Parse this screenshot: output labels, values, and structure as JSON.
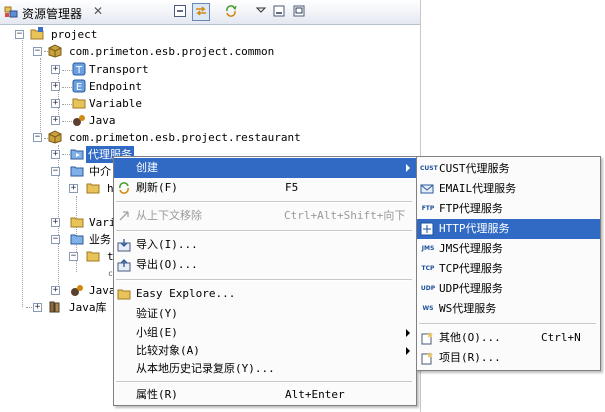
{
  "view": {
    "title": "资源管理器",
    "close_glyph": "✕"
  },
  "tree": {
    "project": "project",
    "common": "com.primeton.esb.project.common",
    "transport": "Transport",
    "endpoint": "Endpoint",
    "variable": "Variable",
    "java": "Java",
    "restaurant": "com.primeton.esb.project.restaurant",
    "proxy_service": "代理服务",
    "intermediary_partial": "中介",
    "vari_partial": "Vari",
    "business_partial": "业务",
    "java2_partial": "Java",
    "javalib": "Java库",
    "h_partial": "h",
    "t_partial": "t",
    "c_partial": "c"
  },
  "context_menu": {
    "create": "创建",
    "refresh": "刷新(F)",
    "refresh_accel": "F5",
    "remove": "从上下文移除",
    "remove_accel": "Ctrl+Alt+Shift+向下",
    "import": "导入(I)...",
    "export": "导出(O)...",
    "easy_explore": "Easy Explore...",
    "validate": "验证(Y)",
    "group": "小组(E)",
    "compare": "比较对象(A)",
    "restore_history": "从本地历史记录复原(Y)...",
    "properties": "属性(R)",
    "properties_accel": "Alt+Enter"
  },
  "submenu": {
    "items": [
      {
        "tag": "CUST",
        "label": "CUST代理服务"
      },
      {
        "tag": "EMAIL",
        "label": "EMAIL代理服务"
      },
      {
        "tag": "FTP",
        "label": "FTP代理服务"
      },
      {
        "tag": "HTTP",
        "label": "HTTP代理服务"
      },
      {
        "tag": "JMS",
        "label": "JMS代理服务"
      },
      {
        "tag": "TCP",
        "label": "TCP代理服务"
      },
      {
        "tag": "UDP",
        "label": "UDP代理服务"
      },
      {
        "tag": "WS",
        "label": "WS代理服务"
      }
    ],
    "other": "其他(O)...",
    "other_accel": "Ctrl+N",
    "project": "项目(R)..."
  },
  "colors": {
    "selection": "#316ac5",
    "folder": "#e8c35a",
    "package": "#c9a240"
  }
}
